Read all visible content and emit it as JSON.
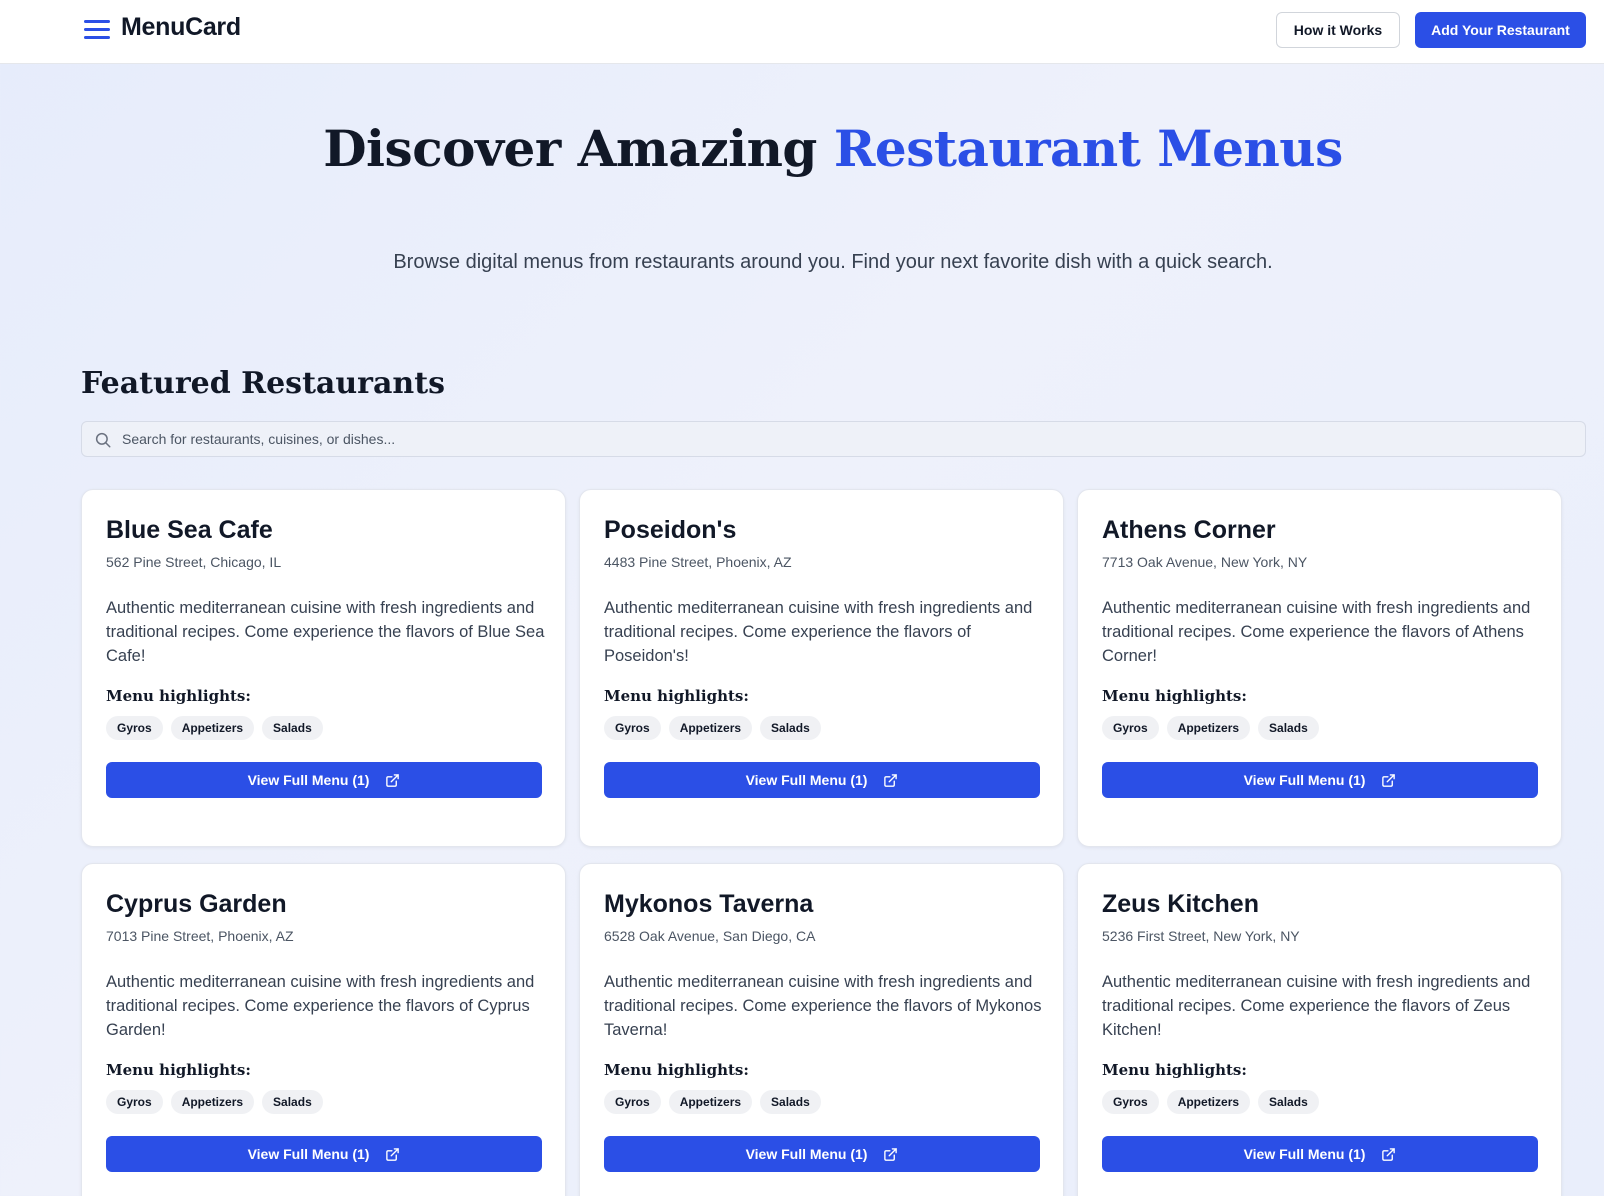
{
  "header": {
    "brand": "MenuCard",
    "how_it_works": "How it Works",
    "add_restaurant": "Add Your Restaurant"
  },
  "hero": {
    "title_part1": "Discover Amazing",
    "title_accent": "Restaurant Menus",
    "subtitle": "Browse digital menus from restaurants around you. Find your next favorite dish with a quick search."
  },
  "featured": {
    "title": "Featured Restaurants",
    "search_placeholder": "Search for restaurants, cuisines, or dishes...",
    "highlights_label": "Menu highlights:",
    "restaurants": [
      {
        "name": "Blue Sea Cafe",
        "address": "562 Pine Street, Chicago, IL",
        "description": "Authentic mediterranean cuisine with fresh ingredients and traditional recipes. Come experience the flavors of Blue Sea Cafe!",
        "highlights": [
          "Gyros",
          "Appetizers",
          "Salads"
        ],
        "button": "View Full Menu (1)"
      },
      {
        "name": "Poseidon's",
        "address": "4483 Pine Street, Phoenix, AZ",
        "description": "Authentic mediterranean cuisine with fresh ingredients and traditional recipes. Come experience the flavors of Poseidon's!",
        "highlights": [
          "Gyros",
          "Appetizers",
          "Salads"
        ],
        "button": "View Full Menu (1)"
      },
      {
        "name": "Athens Corner",
        "address": "7713 Oak Avenue, New York, NY",
        "description": "Authentic mediterranean cuisine with fresh ingredients and traditional recipes. Come experience the flavors of Athens Corner!",
        "highlights": [
          "Gyros",
          "Appetizers",
          "Salads"
        ],
        "button": "View Full Menu (1)"
      },
      {
        "name": "Cyprus Garden",
        "address": "7013 Pine Street, Phoenix, AZ",
        "description": "Authentic mediterranean cuisine with fresh ingredients and traditional recipes. Come experience the flavors of Cyprus Garden!",
        "highlights": [
          "Gyros",
          "Appetizers",
          "Salads"
        ],
        "button": "View Full Menu (1)"
      },
      {
        "name": "Mykonos Taverna",
        "address": "6528 Oak Avenue, San Diego, CA",
        "description": "Authentic mediterranean cuisine with fresh ingredients and traditional recipes. Come experience the flavors of Mykonos Taverna!",
        "highlights": [
          "Gyros",
          "Appetizers",
          "Salads"
        ],
        "button": "View Full Menu (1)"
      },
      {
        "name": "Zeus Kitchen",
        "address": "5236 First Street, New York, NY",
        "description": "Authentic mediterranean cuisine with fresh ingredients and traditional recipes. Come experience the flavors of Zeus Kitchen!",
        "highlights": [
          "Gyros",
          "Appetizers",
          "Salads"
        ],
        "button": "View Full Menu (1)"
      }
    ]
  },
  "colors": {
    "accent": "#2b4fe6",
    "text": "#111827",
    "muted": "#4b5563"
  }
}
